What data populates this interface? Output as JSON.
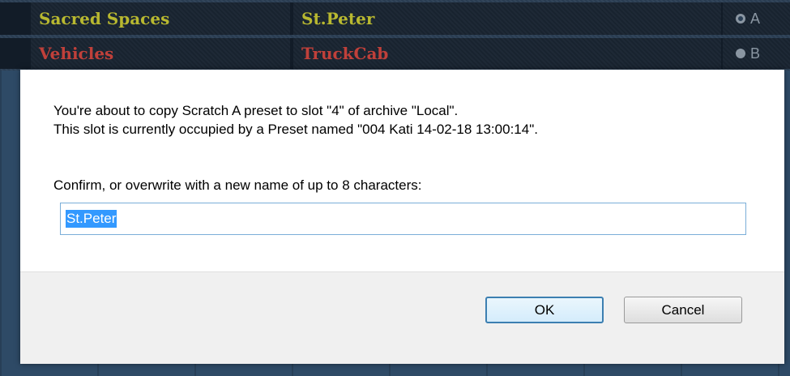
{
  "background": {
    "rows": [
      {
        "category": "Sacred Spaces",
        "category_color": "#b8b830",
        "preset": "St.Peter",
        "preset_color": "#b8b830",
        "slot": "A",
        "selected": true
      },
      {
        "category": "Vehicles",
        "category_color": "#c0403a",
        "preset": "TruckCab",
        "preset_color": "#c0403a",
        "slot": "B",
        "selected": false
      }
    ]
  },
  "dialog": {
    "message_line1": "You're about to copy Scratch A preset to slot \"4\" of archive \"Local\".",
    "message_line2": "This slot is currently occupied by a Preset named \"004 Kati 14-02-18 13:00:14\".",
    "prompt": "Confirm, or overwrite with a new name of up to 8 characters:",
    "name_value": "St.Peter",
    "ok_label": "OK",
    "cancel_label": "Cancel"
  }
}
